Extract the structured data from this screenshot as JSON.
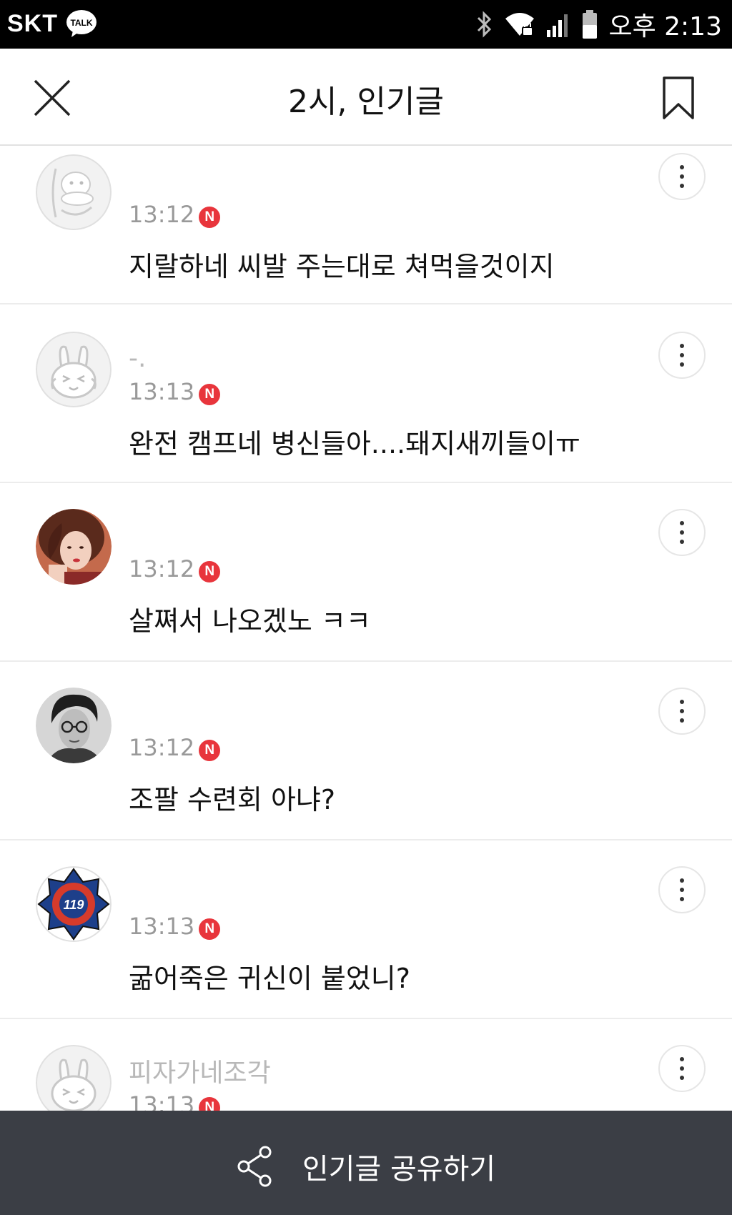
{
  "statusbar": {
    "carrier": "SKT",
    "talk_badge": "TALK",
    "clock": "오후 2:13",
    "icons": [
      "bluetooth-icon",
      "wifi-lock-icon",
      "signal-icon",
      "battery-icon"
    ]
  },
  "header": {
    "title": "2시, 인기글"
  },
  "comments": [
    {
      "name": "",
      "time": "13:12",
      "badge": "N",
      "text": "지랄하네 씨발 주는대로 쳐먹을것이지",
      "avatar": "default-duck-avatar"
    },
    {
      "name": "-.",
      "time": "13:13",
      "badge": "N",
      "text": "완전 캠프네 병신들아....돼지새끼들이ㅠ",
      "avatar": "default-rabbit-avatar"
    },
    {
      "name": "",
      "time": "13:12",
      "badge": "N",
      "text": "살쪄서 나오겠노 ㅋㅋ",
      "avatar": "photo-avatar-woman"
    },
    {
      "name": "",
      "time": "13:12",
      "badge": "N",
      "text": "조팔 수련회 아냐?",
      "avatar": "photo-avatar-man"
    },
    {
      "name": "",
      "time": "13:13",
      "badge": "N",
      "text": "굶어죽은 귀신이 붙었니?",
      "avatar": "fire-service-emblem-avatar",
      "avatar_text": "119"
    },
    {
      "name": "피자가네조각",
      "time": "13:13",
      "badge": "N",
      "text": "",
      "avatar": "default-rabbit-avatar"
    }
  ],
  "footer": {
    "share_label": "인기글 공유하기"
  },
  "colors": {
    "badge": "#e8353c",
    "footer_bg": "#3b3e45",
    "divider": "#ececec"
  }
}
